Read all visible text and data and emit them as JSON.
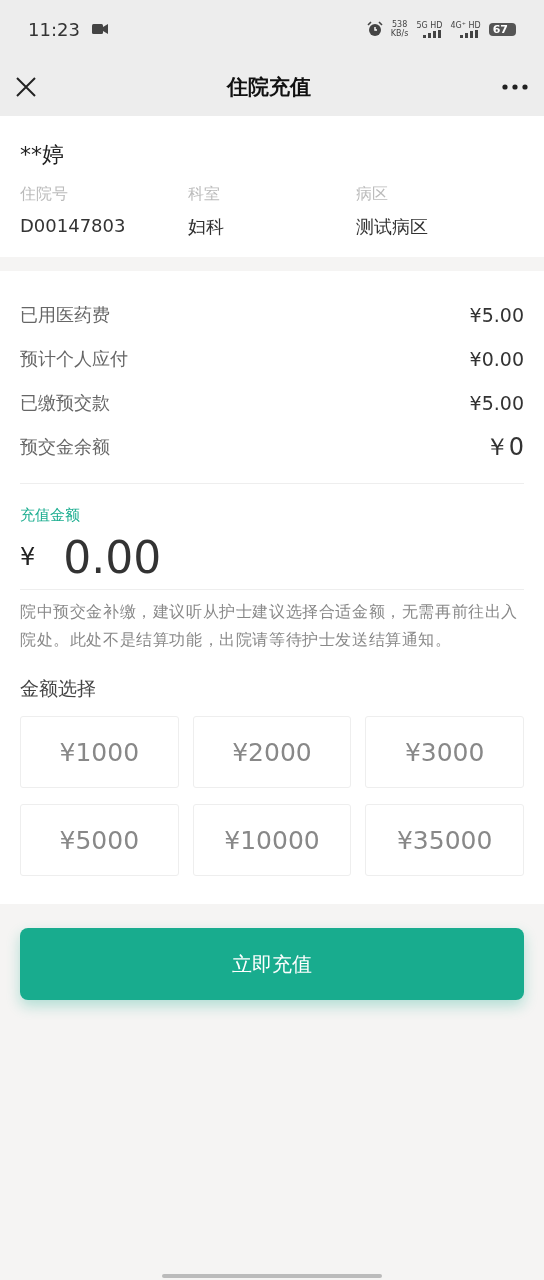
{
  "status_bar": {
    "time": "11:23",
    "speed": "538",
    "speed_unit": "KB/s",
    "network_1": "5G HD",
    "network_2": "4G⁺ HD",
    "battery": "67"
  },
  "nav": {
    "title": "住院充值"
  },
  "patient": {
    "name": "**婷",
    "fields": [
      {
        "label": "住院号",
        "value": "D00147803"
      },
      {
        "label": "科室",
        "value": "妇科"
      },
      {
        "label": "病区",
        "value": "测试病区"
      }
    ]
  },
  "summary": [
    {
      "label": "已用医药费",
      "value": "¥5.00",
      "kind": "normal"
    },
    {
      "label": "预计个人应付",
      "value": "¥0.00",
      "kind": "normal"
    },
    {
      "label": "已缴预交款",
      "value": "¥5.00",
      "kind": "normal"
    },
    {
      "label": "预交金余额",
      "value": "￥0",
      "kind": "large"
    }
  ],
  "recharge": {
    "label": "充值金额",
    "currency": "¥",
    "value": "0.00",
    "notice": "院中预交金补缴，建议听从护士建议选择合适金额，无需再前往出入院处。此处不是结算功能，出院请等待护士发送结算通知。"
  },
  "amount_options": {
    "title": "金额选择",
    "options": [
      {
        "label": "¥1000",
        "selected": false
      },
      {
        "label": "¥2000",
        "selected": false
      },
      {
        "label": "¥3000",
        "selected": false
      },
      {
        "label": "¥5000",
        "selected": false
      },
      {
        "label": "¥10000",
        "selected": false
      },
      {
        "label": "¥35000",
        "selected": false
      }
    ]
  },
  "submit_button": "立即充值"
}
